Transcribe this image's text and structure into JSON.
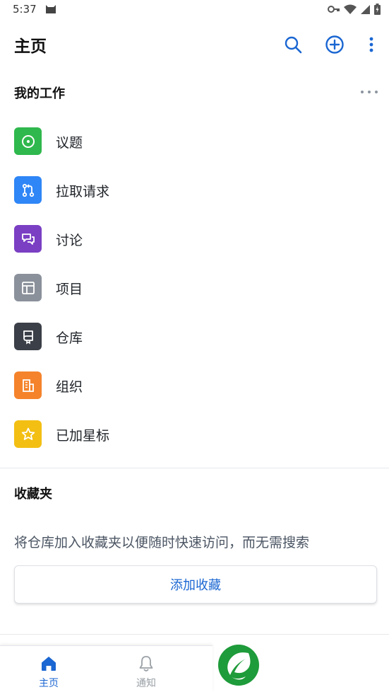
{
  "status_bar": {
    "time": "5:37"
  },
  "header": {
    "title": "主页"
  },
  "my_work": {
    "title": "我的工作",
    "items": [
      {
        "label": "议题",
        "color": "#2fb84d",
        "icon": "issue-icon"
      },
      {
        "label": "拉取请求",
        "color": "#2f86f6",
        "icon": "pull-request-icon"
      },
      {
        "label": "讨论",
        "color": "#7a3fc3",
        "icon": "discussion-icon"
      },
      {
        "label": "项目",
        "color": "#8b919b",
        "icon": "project-table-icon"
      },
      {
        "label": "仓库",
        "color": "#3b3f47",
        "icon": "repository-icon"
      },
      {
        "label": "组织",
        "color": "#f5832b",
        "icon": "organization-building-icon"
      },
      {
        "label": "已加星标",
        "color": "#f3bf13",
        "icon": "star-icon"
      }
    ]
  },
  "favorites": {
    "title": "收藏夹",
    "description": "将仓库加入收藏夹以便随时快速访问，而无需搜索",
    "button_label": "添加收藏"
  },
  "bottom_nav": {
    "home_label": "主页",
    "notify_label": "通知"
  },
  "colors": {
    "accent": "#1a66d2",
    "logo_green": "#1e9b3a"
  }
}
